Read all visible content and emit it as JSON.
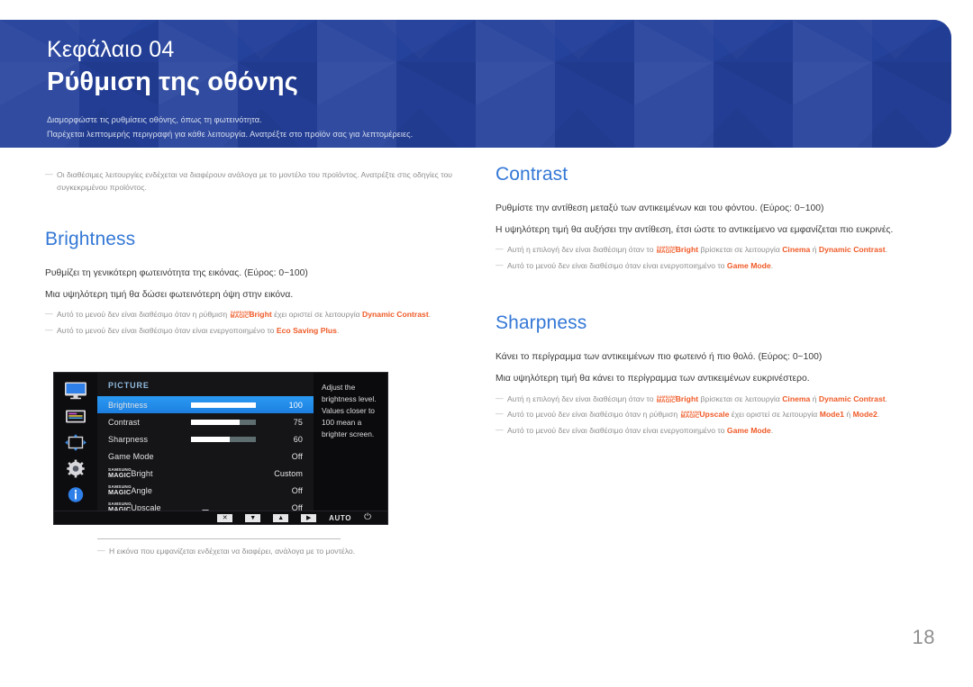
{
  "page": {
    "number": "18",
    "accent_blue": "#3478d6",
    "banner_blue": "#24419b",
    "highlight_orange": "#ef5a27"
  },
  "banner": {
    "chapter_label": "Κεφάλαιο 04",
    "chapter_title": "Ρύθμιση της οθόνης",
    "subtitle_line1": "Διαμορφώστε τις ρυθμίσεις οθόνης, όπως τη φωτεινότητα.",
    "subtitle_line2": "Παρέχεται λεπτομερής περιγραφή για κάθε λειτουργία. Ανατρέξτε στο προϊόν σας για λεπτομέρειες."
  },
  "left_column": {
    "top_note": {
      "dash": "―",
      "text": "Οι διαθέσιμες λειτουργίες ενδέχεται να διαφέρουν ανάλογα με το μοντέλο του προϊόντος. Ανατρέξτε στις οδηγίες του συγκεκριμένου προϊόντος."
    },
    "section_title": "Brightness",
    "body_line1": "Ρυθμίζει τη γενικότερη φωτεινότητα της εικόνας. (Εύρος: 0~100)",
    "body_line2": "Μια υψηλότερη τιμή θα δώσει φωτεινότερη όψη στην εικόνα.",
    "notes": [
      {
        "dash": "―",
        "pre": "Αυτό το μενού δεν είναι διαθέσιμο όταν η ρύθμιση ",
        "magic_top": "SAMSUNG",
        "magic_bottom": "MAGIC",
        "magic_suffix": "Bright",
        "mid": " έχει οριστεί σε λειτουργία ",
        "hl1": "Dynamic Contrast",
        "post": "."
      },
      {
        "dash": "―",
        "pre": "Αυτό το μενού δεν είναι διαθέσιμο όταν είναι ενεργοποιημένο το ",
        "hl1": "Eco Saving Plus",
        "post": "."
      }
    ],
    "figure_note": {
      "dash": "―",
      "text": "Η εικόνα που εμφανίζεται ενδέχεται να διαφέρει, ανάλογα με το μοντέλο."
    }
  },
  "right_column": {
    "contrast": {
      "section_title": "Contrast",
      "body_line1": "Ρυθμίστε την αντίθεση μεταξύ των αντικειμένων και του φόντου. (Εύρος: 0~100)",
      "body_line2": "Η υψηλότερη τιμή θα αυξήσει την αντίθεση, έτσι ώστε το αντικείμενο να εμφανίζεται πιο ευκρινές.",
      "notes": [
        {
          "dash": "―",
          "pre": "Αυτή η επιλογή δεν είναι διαθέσιμη όταν το ",
          "magic_top": "SAMSUNG",
          "magic_bottom": "MAGIC",
          "magic_suffix": "Bright",
          "mid": " βρίσκεται σε λειτουργία ",
          "hl1": "Cinema",
          "conj": " ή ",
          "hl2": "Dynamic Contrast",
          "post": "."
        },
        {
          "dash": "―",
          "pre": "Αυτό το μενού δεν είναι διαθέσιμο όταν είναι ενεργοποιημένο το ",
          "hl1": "Game Mode",
          "post": "."
        }
      ]
    },
    "sharpness": {
      "section_title": "Sharpness",
      "body_line1": "Κάνει το περίγραμμα των αντικειμένων πιο φωτεινό ή πιο θολό. (Εύρος: 0~100)",
      "body_line2": "Μια υψηλότερη τιμή θα κάνει το περίγραμμα των αντικειμένων ευκρινέστερο.",
      "notes": [
        {
          "dash": "―",
          "pre": "Αυτή η επιλογή δεν είναι διαθέσιμη όταν το ",
          "magic_top": "SAMSUNG",
          "magic_bottom": "MAGIC",
          "magic_suffix": "Bright",
          "mid": " βρίσκεται σε λειτουργία ",
          "hl1": "Cinema",
          "conj": " ή ",
          "hl2": "Dynamic Contrast",
          "post": "."
        },
        {
          "dash": "―",
          "pre": "Αυτό το μενού δεν είναι διαθέσιμο όταν η ρύθμιση ",
          "magic_top": "SAMSUNG",
          "magic_bottom": "MAGIC",
          "magic_suffix": "Upscale",
          "mid": " έχει οριστεί σε λειτουργία ",
          "hl1": "Mode1",
          "conj": " ή ",
          "hl2": "Mode2",
          "post": "."
        },
        {
          "dash": "―",
          "pre": "Αυτό το μενού δεν είναι διαθέσιμο όταν είναι ενεργοποιημένο το ",
          "hl1": "Game Mode",
          "post": "."
        }
      ]
    }
  },
  "osd": {
    "title": "PICTURE",
    "rail_icons": [
      "monitor-picture-icon",
      "onscreen-display-icon",
      "system-arrows-icon",
      "setup-gear-icon",
      "information-icon"
    ],
    "rows": [
      {
        "label": "Brightness",
        "value": "100",
        "slider_pct": 100,
        "selected": true,
        "magic": false
      },
      {
        "label": "Contrast",
        "value": "75",
        "slider_pct": 75,
        "selected": false,
        "magic": false
      },
      {
        "label": "Sharpness",
        "value": "60",
        "slider_pct": 60,
        "selected": false,
        "magic": false
      },
      {
        "label": "Game Mode",
        "value": "Off",
        "slider_pct": null,
        "selected": false,
        "magic": false
      },
      {
        "label": "Bright",
        "value": "Custom",
        "slider_pct": null,
        "selected": false,
        "magic": true,
        "magic_top": "SAMSUNG",
        "magic_bottom": "MAGIC"
      },
      {
        "label": "Angle",
        "value": "Off",
        "slider_pct": null,
        "selected": false,
        "magic": true,
        "magic_top": "SAMSUNG",
        "magic_bottom": "MAGIC"
      },
      {
        "label": "Upscale",
        "value": "Off",
        "slider_pct": null,
        "selected": false,
        "magic": true,
        "magic_top": "SAMSUNG",
        "magic_bottom": "MAGIC"
      }
    ],
    "help_text": "Adjust the brightness level. Values closer to 100 mean a brighter screen.",
    "bottom_keys": [
      {
        "name": "exit-key",
        "glyph": "✕"
      },
      {
        "name": "down-key",
        "glyph": "▼"
      },
      {
        "name": "up-key",
        "glyph": "▲"
      },
      {
        "name": "enter-key",
        "glyph": "▶"
      }
    ],
    "auto_label": "AUTO",
    "power_glyph": "⏻"
  }
}
